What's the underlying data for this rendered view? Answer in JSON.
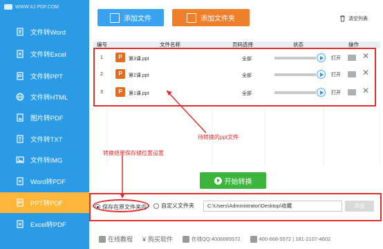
{
  "logo": {
    "text": "WWW.XJ PDF.COM"
  },
  "sidebar": {
    "items": [
      {
        "label": "文件转Word",
        "icon": "word-doc-icon",
        "active": false
      },
      {
        "label": "文件转Excel",
        "icon": "excel-doc-icon",
        "active": false
      },
      {
        "label": "文件转PPT",
        "icon": "ppt-doc-icon",
        "active": false
      },
      {
        "label": "文件转HTML",
        "icon": "globe-icon",
        "active": false
      },
      {
        "label": "图片转PDF",
        "icon": "image-doc-icon",
        "active": false
      },
      {
        "label": "文件转TXT",
        "icon": "txt-doc-icon",
        "active": false
      },
      {
        "label": "文件转IMG",
        "icon": "img-icon",
        "active": false
      },
      {
        "label": "Word转PDF",
        "icon": "word-pdf-icon",
        "active": false
      },
      {
        "label": "PPT转PDF",
        "icon": "ppt-pdf-icon",
        "active": true
      },
      {
        "label": "Excel转PDF",
        "icon": "excel-pdf-icon",
        "active": false
      }
    ]
  },
  "toolbar": {
    "add_file": "添加文件",
    "add_folder": "添加文件夹",
    "clear_list": "清空列表"
  },
  "table": {
    "headers": {
      "num": "编号",
      "name": "文件名称",
      "pages": "页码选择",
      "status": "状态",
      "ops": "操作"
    },
    "rows": [
      {
        "num": "1",
        "name": "第3课.ppt",
        "pages": "全部",
        "open": "打开"
      },
      {
        "num": "2",
        "name": "第2课.ppt",
        "pages": "全部",
        "open": "打开"
      },
      {
        "num": "3",
        "name": "第1课.ppt",
        "pages": "全部",
        "open": "打开"
      }
    ]
  },
  "annotations": {
    "pending_files": "待转换的ppt文件",
    "save_location": "转换结果保存储位置设置"
  },
  "start_button": "开始转换",
  "save": {
    "option_original": "保存在原文件夹内",
    "option_custom": "自定义文件夹",
    "path": "C:\\Users\\Administrator\\Desktop\\收藏",
    "browse": "浏览"
  },
  "footer": {
    "online_tutorial": "在线教程",
    "buy": "购买软件",
    "qq": "在线QQ:4006685572",
    "phone": "400-668-5572 | 181-2107-4602"
  },
  "colors": {
    "sidebar": "#2c9be6",
    "active": "#fdb63a",
    "add_file_btn": "#3aa3ef",
    "add_folder_btn": "#f07f2b",
    "start_btn": "#3db53d",
    "annotation": "#e32b2b"
  }
}
